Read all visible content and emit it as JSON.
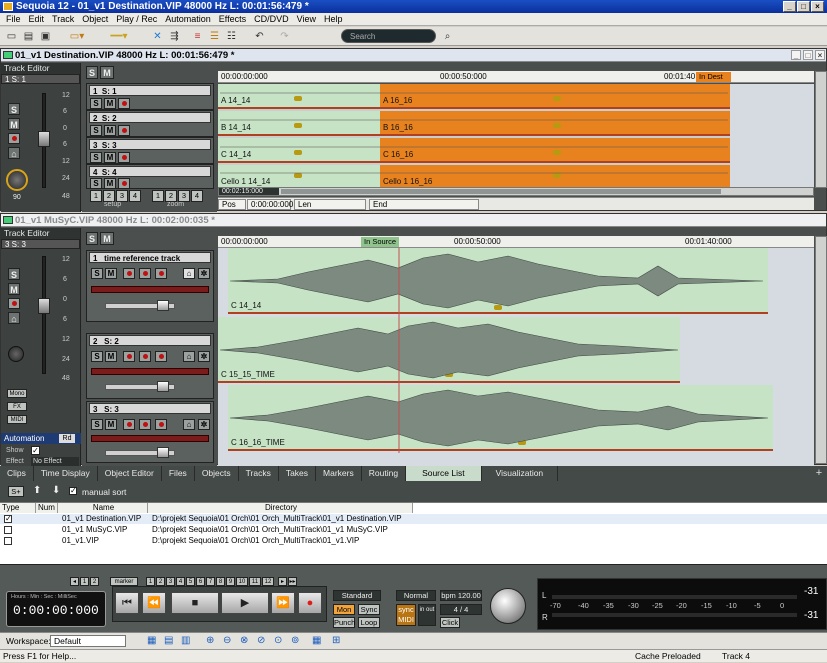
{
  "app": {
    "title": "Sequoia 12 - 01_v1 Destination.VIP   48000 Hz L: 00:01:56:479 *"
  },
  "menu": [
    "File",
    "Edit",
    "Track",
    "Object",
    "Play / Rec",
    "Automation",
    "Effects",
    "CD/DVD",
    "View",
    "Help"
  ],
  "toolbar": {
    "search_placeholder": "Search"
  },
  "window1": {
    "title": "01_v1 Destination.VIP   48000 Hz L: 00:01:56:479 *",
    "track_editor_label": "Track Editor",
    "track_selector": "1  S: 1",
    "db_marks": [
      "12",
      "6",
      "0",
      "6",
      "12",
      "24",
      "48"
    ],
    "pan_value": "90",
    "setup_label": "setup",
    "zoom_label": "zoom",
    "group_numbers": [
      "1",
      "2",
      "3",
      "4"
    ],
    "ruler_labels": [
      "00:00:00:000",
      "00:00:50:000",
      "00:01:40"
    ],
    "in_dest_label": "In Dest",
    "tracks": [
      {
        "label": "S: 1",
        "num": "1",
        "clip_left": "A 14_14",
        "clip_right": "A 16_16"
      },
      {
        "label": "S: 2",
        "num": "2",
        "clip_left": "B 14_14",
        "clip_right": "B 16_16"
      },
      {
        "label": "S: 3",
        "num": "3",
        "clip_left": "C 14_14",
        "clip_right": "C 16_16"
      },
      {
        "label": "S: 4",
        "num": "4",
        "clip_left": "Cello 1 14_14",
        "clip_right": "Cello 1 16_16"
      }
    ],
    "timecode": "00:02:15:000",
    "pos_label": "Pos",
    "pos_value": "0:00:00:000",
    "len_label": "Len",
    "end_label": "End"
  },
  "window2": {
    "title": "01_v1 MuSyC.VIP   48000 Hz L: 00:02:00:035 *",
    "track_editor_label": "Track Editor",
    "track_selector": "3  S: 3",
    "db_marks": [
      "12",
      "6",
      "0",
      "6",
      "12",
      "24",
      "48"
    ],
    "in_source_label": "In Source",
    "ruler_labels": [
      "00:00:00:000",
      "00:00:50:000",
      "00:01:40:000"
    ],
    "automation_label": "Automation",
    "rd_label": "Rd",
    "show_label": "Show",
    "effect_label": "Effect",
    "no_effect": "No Effect",
    "side_buttons": [
      "Mono",
      "FX",
      "MIDI"
    ],
    "tracks": [
      {
        "num": "1",
        "label": "time reference track",
        "clip": "C 14_14"
      },
      {
        "num": "2",
        "label": "S: 2",
        "clip": "C 15_15_TIME"
      },
      {
        "num": "3",
        "label": "S: 3",
        "clip": "C 16_16_TIME"
      }
    ]
  },
  "tabs": [
    "Clips",
    "Time Display",
    "Object Editor",
    "Files",
    "Objects",
    "Tracks",
    "Takes",
    "Markers",
    "Routing",
    "Source List",
    "Visualization"
  ],
  "active_tab": "Source List",
  "source_toolbar": {
    "manual_sort": "manual sort",
    "add_label": "S+"
  },
  "source_list": {
    "columns": [
      "Type",
      "Num",
      "Name",
      "Directory"
    ],
    "rows": [
      {
        "name": "01_v1 Destination.VIP",
        "dir": "D:\\projekt Sequoia\\01 Orch\\01 Orch_MultiTrack\\01_v1 Destination.VIP",
        "checked": true
      },
      {
        "name": "01_v1 MuSyC.VIP",
        "dir": "D:\\projekt Sequoia\\01 Orch\\01 Orch_MultiTrack\\01_v1 MuSyC.VIP",
        "checked": false
      },
      {
        "name": "01_v1.VIP",
        "dir": "D:\\projekt Sequoia\\01 Orch\\01 Orch_MultiTrack\\01_v1.VIP",
        "checked": false
      }
    ]
  },
  "transport": {
    "time_header": "Hours : Min : Sec : MilliSec",
    "time": "0:00:00:000",
    "marker_label": "marker",
    "marker_numbers": [
      "1",
      "2",
      "3",
      "4",
      "5",
      "6",
      "7",
      "8",
      "9",
      "10",
      "11",
      "12"
    ],
    "standard": "Standard",
    "mon": "Mon",
    "sync": "Sync",
    "punch": "Punch",
    "loop": "Loop",
    "normal": "Normal",
    "bpm": "bpm 120.00",
    "signature": "4 / 4",
    "click": "Click",
    "sync_box": "sync",
    "midi_box": "MIDI",
    "in_out": "in out",
    "meter_scale": [
      "-70",
      "-40",
      "-35",
      "-30",
      "-25",
      "-20",
      "-15",
      "-10",
      "-5",
      "0"
    ],
    "meter_l": "L",
    "meter_r": "R",
    "meter_peak_l": "-31",
    "meter_peak_r": "-31"
  },
  "workspace": {
    "label": "Workspace:",
    "value": "Default"
  },
  "status": {
    "help": "Press F1 for Help...",
    "cache": "Cache Preloaded",
    "track": "Track 4"
  },
  "colors": {
    "orange": "#e8821e",
    "green_clip": "#c7e3c6",
    "dark_panel": "#4a4f4d"
  }
}
